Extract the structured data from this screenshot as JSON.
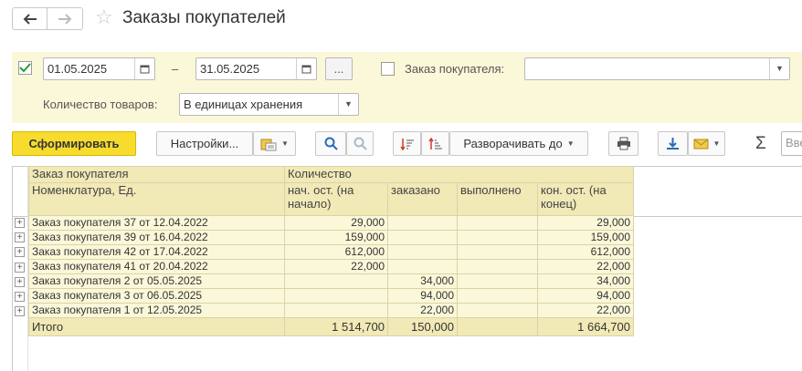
{
  "window": {
    "title": "Заказы покупателей",
    "back_icon": "arrow-left-icon",
    "forward_icon": "arrow-right-icon",
    "favorite_icon": "star-icon"
  },
  "filters": {
    "period_enabled": true,
    "date_from": "01.05.2025",
    "date_dash": "–",
    "date_to": "31.05.2025",
    "period_button": "...",
    "order_filter_enabled": false,
    "order_label": "Заказ покупателя:",
    "order_value": "",
    "quantity_label": "Количество товаров:",
    "quantity_value": "В единицах хранения"
  },
  "toolbar": {
    "generate": "Сформировать",
    "settings": "Настройки...",
    "expand_to": "Разворачивать до",
    "sum_symbol": "Σ",
    "search_placeholder": "Вве"
  },
  "report": {
    "headers": {
      "col1_line1": "Заказ покупателя",
      "col1_line2": "Номенклатура, Ед.",
      "qty_group": "Количество",
      "opening": "нач. ост. (на начало)",
      "ordered": "заказано",
      "done": "выполнено",
      "closing": "кон. ост. (на конец)"
    },
    "rows": [
      {
        "name": "Заказ покупателя 37 от 12.04.2022",
        "opening": "29,000",
        "ordered": "",
        "done": "",
        "closing": "29,000"
      },
      {
        "name": "Заказ покупателя 39 от 16.04.2022",
        "opening": "159,000",
        "ordered": "",
        "done": "",
        "closing": "159,000"
      },
      {
        "name": "Заказ покупателя 42 от 17.04.2022",
        "opening": "612,000",
        "ordered": "",
        "done": "",
        "closing": "612,000"
      },
      {
        "name": "Заказ покупателя 41 от 20.04.2022",
        "opening": "22,000",
        "ordered": "",
        "done": "",
        "closing": "22,000"
      },
      {
        "name": "Заказ покупателя 2 от 05.05.2025",
        "opening": "",
        "ordered": "34,000",
        "done": "",
        "closing": "34,000"
      },
      {
        "name": "Заказ покупателя 3 от 06.05.2025",
        "opening": "",
        "ordered": "94,000",
        "done": "",
        "closing": "94,000"
      },
      {
        "name": "Заказ покупателя 1 от 12.05.2025",
        "opening": "",
        "ordered": "22,000",
        "done": "",
        "closing": "22,000"
      }
    ],
    "total": {
      "label": "Итого",
      "opening": "1 514,700",
      "ordered": "150,000",
      "done": "",
      "closing": "1 664,700"
    }
  },
  "colors": {
    "accent_button": "#f7dc2e",
    "panel_background": "#fbf8d9",
    "header_background": "#f1e9b6",
    "icon_blue": "#2a6ab6",
    "icon_red": "#d23b2b"
  }
}
